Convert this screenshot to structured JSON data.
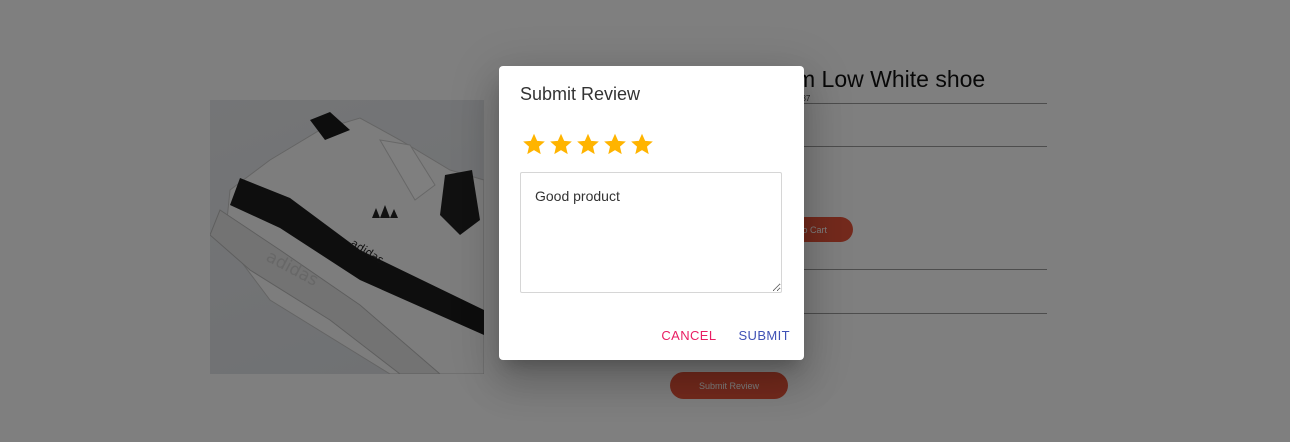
{
  "product": {
    "title": "Adidas Forum Low White shoe",
    "id": "Product # 6143f1cd0f1e8d88a5023887",
    "add_to_cart_label": "Add to Cart",
    "submit_review_label": "Submit Review"
  },
  "dialog": {
    "title": "Submit Review",
    "rating": 5,
    "rating_max": 5,
    "review_text": "Good product",
    "cancel_label": "CANCEL",
    "submit_label": "SUBMIT"
  },
  "colors": {
    "star": "#ffb400",
    "cancel": "#e91e63",
    "submit": "#3f51b5",
    "accent_button": "#e8543a"
  }
}
